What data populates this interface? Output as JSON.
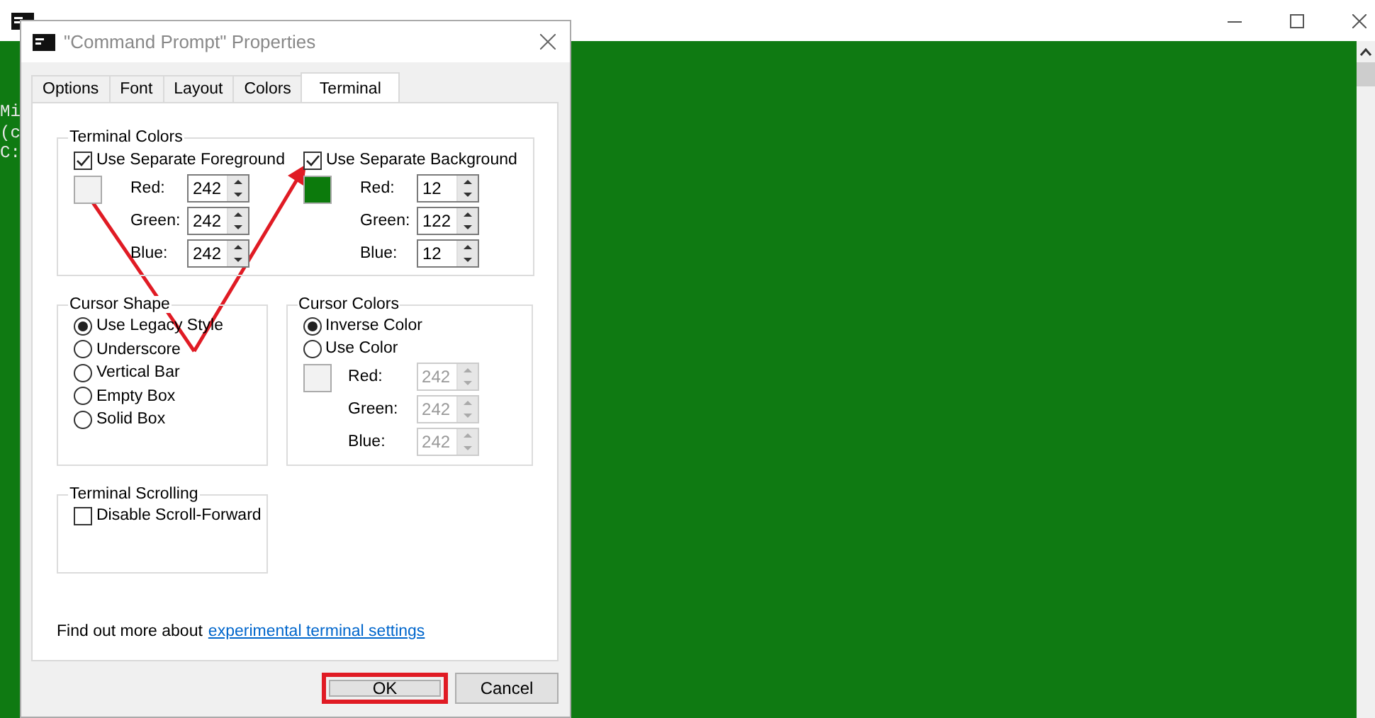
{
  "console": {
    "lines": [
      "Mi",
      "(c",
      "C:"
    ]
  },
  "dialog": {
    "title": "\"Command Prompt\" Properties",
    "tabs": [
      {
        "label": "Options",
        "selected": false
      },
      {
        "label": "Font",
        "selected": false
      },
      {
        "label": "Layout",
        "selected": false
      },
      {
        "label": "Colors",
        "selected": false
      },
      {
        "label": "Terminal",
        "selected": true
      }
    ],
    "terminal_colors": {
      "title": "Terminal Colors",
      "columns": [
        {
          "label": "Use Separate Foreground",
          "checked": true,
          "color": "#f2f2f2",
          "fields": [
            {
              "label": "Red:",
              "value": "242"
            },
            {
              "label": "Green:",
              "value": "242"
            },
            {
              "label": "Blue:",
              "value": "242"
            }
          ]
        },
        {
          "label": "Use Separate Background",
          "checked": true,
          "color": "#0c7a0c",
          "fields": [
            {
              "label": "Red:",
              "value": "12"
            },
            {
              "label": "Green:",
              "value": "122"
            },
            {
              "label": "Blue:",
              "value": "12"
            }
          ]
        }
      ]
    },
    "cursor_shape": {
      "title": "Cursor Shape",
      "options": [
        {
          "label": "Use Legacy Style",
          "selected": true
        },
        {
          "label": "Underscore",
          "selected": false
        },
        {
          "label": "Vertical Bar",
          "selected": false
        },
        {
          "label": "Empty Box",
          "selected": false
        },
        {
          "label": "Solid Box",
          "selected": false
        }
      ]
    },
    "cursor_colors": {
      "title": "Cursor Colors",
      "options": [
        {
          "label": "Inverse Color",
          "selected": true
        },
        {
          "label": "Use Color",
          "selected": false
        }
      ],
      "color": "#f2f2f2",
      "disabled": true,
      "fields": [
        {
          "label": "Red:",
          "value": "242"
        },
        {
          "label": "Green:",
          "value": "242"
        },
        {
          "label": "Blue:",
          "value": "242"
        }
      ]
    },
    "terminal_scrolling": {
      "title": "Terminal Scrolling",
      "checkbox": {
        "label": "Disable Scroll-Forward",
        "checked": false
      }
    },
    "footer": {
      "text": "Find out more about",
      "link": "experimental terminal settings"
    },
    "buttons": [
      {
        "label": "OK",
        "highlighted": true
      },
      {
        "label": "Cancel",
        "highlighted": false
      }
    ]
  }
}
